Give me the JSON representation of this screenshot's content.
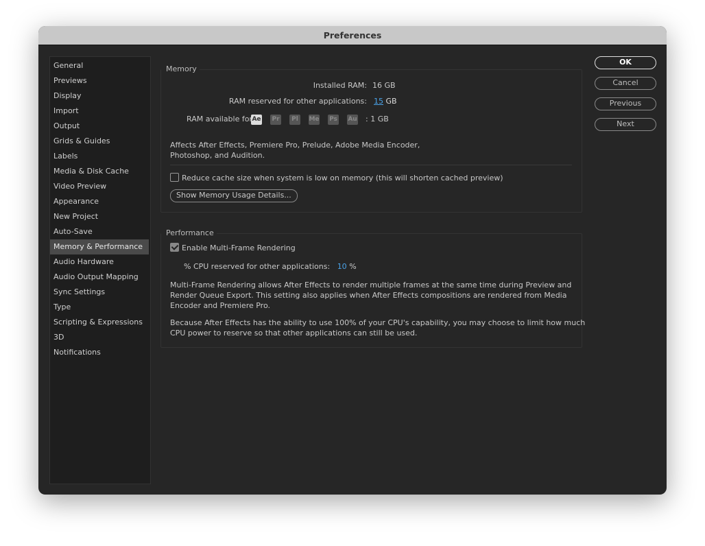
{
  "window": {
    "title": "Preferences"
  },
  "sidebar": {
    "items": [
      "General",
      "Previews",
      "Display",
      "Import",
      "Output",
      "Grids & Guides",
      "Labels",
      "Media & Disk Cache",
      "Video Preview",
      "Appearance",
      "New Project",
      "Auto-Save",
      "Memory & Performance",
      "Audio Hardware",
      "Audio Output Mapping",
      "Sync Settings",
      "Type",
      "Scripting & Expressions",
      "3D",
      "Notifications"
    ],
    "selected": "Memory & Performance"
  },
  "buttons": {
    "ok": "OK",
    "cancel": "Cancel",
    "previous": "Previous",
    "next": "Next"
  },
  "memory": {
    "label": "Memory",
    "installed_label": "Installed RAM:",
    "installed_value": "16 GB",
    "reserved_label": "RAM reserved for other applications:",
    "reserved_value": "15",
    "reserved_unit": "GB",
    "available_label": "RAM available for",
    "apps": [
      "Ae",
      "Pr",
      "Pl",
      "Me",
      "Ps",
      "Au"
    ],
    "available_value": ":  1 GB",
    "desc_1": "Affects After Effects, Premiere Pro, Prelude, Adobe Media Encoder,",
    "desc_2": "Photoshop, and Audition.",
    "reduce_cache_label": "Reduce cache size when system is low on memory (this will shorten cached preview)",
    "reduce_cache_checked": false,
    "details_button": "Show Memory Usage Details..."
  },
  "performance": {
    "label": "Performance",
    "mfr_label": "Enable Multi-Frame Rendering",
    "mfr_checked": true,
    "cpu_label": "% CPU reserved for other applications:",
    "cpu_value": "10",
    "cpu_unit": "%",
    "desc_1": "Multi-Frame Rendering allows After Effects to render multiple frames at the same time during Preview and",
    "desc_2": "Render Queue Export. This setting also applies when After Effects compositions are rendered from Media",
    "desc_3": "Encoder and Premiere Pro.",
    "desc_4": "Because After Effects has the ability to use 100% of your CPU's capability, you may choose to limit how much",
    "desc_5": "CPU power to reserve so that other applications can still be used."
  },
  "colors": {
    "accent": "#4aa3e8",
    "background": "#262626"
  }
}
